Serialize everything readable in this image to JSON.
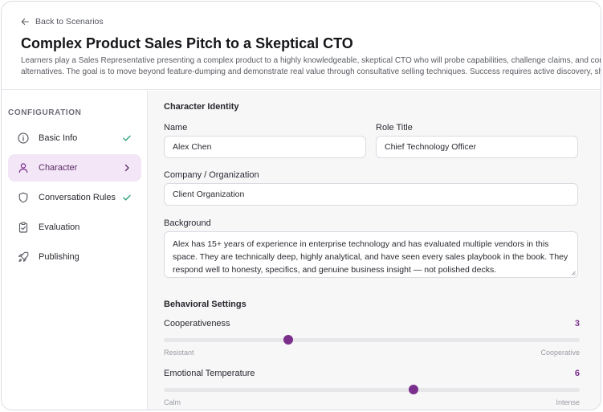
{
  "header": {
    "back_label": "Back to Scenarios",
    "title": "Complex Product Sales Pitch to a Skeptical CTO",
    "description_line1": "Learners play a Sales Representative presenting a complex product to a highly knowledgeable, skeptical CTO who will probe capabilities, challenge claims, and compare",
    "description_line2": "alternatives. The goal is to move beyond feature-dumping and demonstrate real value through consultative selling techniques. Success requires active discovery, sharp..."
  },
  "sidebar": {
    "heading": "CONFIGURATION",
    "items": [
      {
        "label": "Basic Info",
        "icon": "info-icon",
        "status": "complete"
      },
      {
        "label": "Character",
        "icon": "user-icon",
        "status": "active"
      },
      {
        "label": "Conversation Rules",
        "icon": "shield-icon",
        "status": "complete"
      },
      {
        "label": "Evaluation",
        "icon": "clipboard-check-icon",
        "status": "none"
      },
      {
        "label": "Publishing",
        "icon": "rocket-icon",
        "status": "none"
      }
    ]
  },
  "character": {
    "section_title": "Character Identity",
    "name_label": "Name",
    "name_value": "Alex Chen",
    "role_label": "Role Title",
    "role_value": "Chief Technology Officer",
    "company_label": "Company / Organization",
    "company_value": "Client Organization",
    "background_label": "Background",
    "background_value": "Alex has 15+ years of experience in enterprise technology and has evaluated multiple vendors in this space. They are technically deep, highly analytical, and have seen every sales playbook in the book. They respond well to honesty, specifics, and genuine business insight — not polished decks."
  },
  "behavior": {
    "section_title": "Behavioral Settings",
    "sliders": [
      {
        "label": "Cooperativeness",
        "value": 3,
        "display": "3",
        "min": 0,
        "max": 10,
        "min_label": "Resistant",
        "max_label": "Cooperative"
      },
      {
        "label": "Emotional Temperature",
        "value": 6,
        "display": "6",
        "min": 0,
        "max": 10,
        "min_label": "Calm",
        "max_label": "Intense"
      }
    ]
  },
  "colors": {
    "accent": "#7a2f8c",
    "active_bg": "#f3e6f6",
    "check": "#2fa37a"
  }
}
